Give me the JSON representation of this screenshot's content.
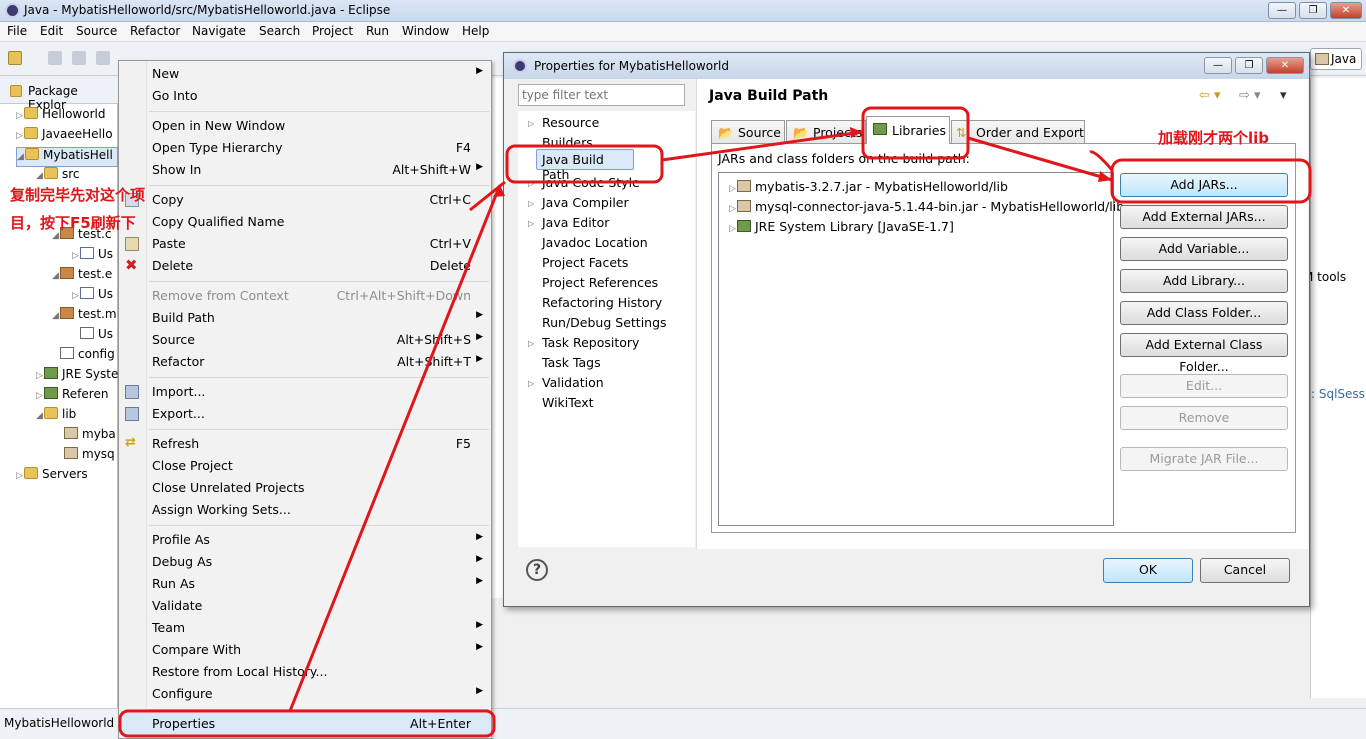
{
  "window": {
    "title": "Java - MybatisHelloworld/src/MybatisHelloworld.java - Eclipse",
    "minimize": "—",
    "maximize": "❐",
    "close": "✕"
  },
  "menubar": [
    "File",
    "Edit",
    "Source",
    "Refactor",
    "Navigate",
    "Search",
    "Project",
    "Run",
    "Window",
    "Help"
  ],
  "perspective": "Java",
  "package_explorer": {
    "title": "Package Explor",
    "rows": [
      {
        "label": "Helloworld",
        "icon": "project-icon"
      },
      {
        "label": "JavaeeHello",
        "icon": "project-icon"
      },
      {
        "label": "MybatisHell",
        "icon": "project-icon"
      },
      {
        "label": "src",
        "icon": "src-folder-icon"
      },
      {
        "label": "test.c",
        "icon": "package-icon"
      },
      {
        "label": "Us",
        "icon": "java-file-icon"
      },
      {
        "label": "test.e",
        "icon": "package-icon"
      },
      {
        "label": "Us",
        "icon": "java-file-icon"
      },
      {
        "label": "test.m",
        "icon": "package-icon"
      },
      {
        "label": "Us",
        "icon": "xml-file-icon"
      },
      {
        "label": "config",
        "icon": "xml-file-icon"
      },
      {
        "label": "JRE Syste",
        "icon": "library-icon"
      },
      {
        "label": "Referen",
        "icon": "library-icon"
      },
      {
        "label": "lib",
        "icon": "folder-icon"
      },
      {
        "label": "myba",
        "icon": "jar-icon"
      },
      {
        "label": "mysq",
        "icon": "jar-icon"
      },
      {
        "label": "Servers",
        "icon": "folder-icon"
      }
    ]
  },
  "status_bar": "MybatisHelloworld",
  "context_menu": {
    "items": [
      {
        "label": "New",
        "shortcut": "",
        "submenu": true
      },
      {
        "label": "Go Into",
        "shortcut": ""
      },
      {
        "label": "Open in New Window",
        "shortcut": ""
      },
      {
        "label": "Open Type Hierarchy",
        "shortcut": "F4"
      },
      {
        "label": "Show In",
        "shortcut": "Alt+Shift+W",
        "submenu": true
      },
      {
        "label": "Copy",
        "shortcut": "Ctrl+C"
      },
      {
        "label": "Copy Qualified Name",
        "shortcut": ""
      },
      {
        "label": "Paste",
        "shortcut": "Ctrl+V"
      },
      {
        "label": "Delete",
        "shortcut": "Delete"
      },
      {
        "label": "Remove from Context",
        "shortcut": "Ctrl+Alt+Shift+Down"
      },
      {
        "label": "Build Path",
        "shortcut": "",
        "submenu": true
      },
      {
        "label": "Source",
        "shortcut": "Alt+Shift+S",
        "submenu": true
      },
      {
        "label": "Refactor",
        "shortcut": "Alt+Shift+T",
        "submenu": true
      },
      {
        "label": "Import...",
        "shortcut": ""
      },
      {
        "label": "Export...",
        "shortcut": ""
      },
      {
        "label": "Refresh",
        "shortcut": "F5"
      },
      {
        "label": "Close Project",
        "shortcut": ""
      },
      {
        "label": "Close Unrelated Projects",
        "shortcut": ""
      },
      {
        "label": "Assign Working Sets...",
        "shortcut": ""
      },
      {
        "label": "Profile As",
        "shortcut": "",
        "submenu": true
      },
      {
        "label": "Debug As",
        "shortcut": "",
        "submenu": true
      },
      {
        "label": "Run As",
        "shortcut": "",
        "submenu": true
      },
      {
        "label": "Validate",
        "shortcut": ""
      },
      {
        "label": "Team",
        "shortcut": "",
        "submenu": true
      },
      {
        "label": "Compare With",
        "shortcut": "",
        "submenu": true
      },
      {
        "label": "Restore from Local History...",
        "shortcut": ""
      },
      {
        "label": "Configure",
        "shortcut": "",
        "submenu": true
      },
      {
        "label": "Properties",
        "shortcut": "Alt+Enter"
      }
    ]
  },
  "dialog": {
    "title": "Properties for MybatisHelloworld",
    "filter_placeholder": "type filter text",
    "nav": [
      "Resource",
      "Builders",
      "Java Build Path",
      "Java Code Style",
      "Java Compiler",
      "Java Editor",
      "Javadoc Location",
      "Project Facets",
      "Project References",
      "Refactoring History",
      "Run/Debug Settings",
      "Task Repository",
      "Task Tags",
      "Validation",
      "WikiText"
    ],
    "page_title": "Java Build Path",
    "tabs": [
      "Source",
      "Projects",
      "Libraries",
      "Order and Export"
    ],
    "jars_label": "JARs and class folders on the build path:",
    "entries": [
      "mybatis-3.2.7.jar - MybatisHelloworld/lib",
      "mysql-connector-java-5.1.44-bin.jar - MybatisHelloworld/lib",
      "JRE System Library [JavaSE-1.7]"
    ],
    "buttons": [
      "Add JARs...",
      "Add External JARs...",
      "Add Variable...",
      "Add Library...",
      "Add Class Folder...",
      "Add External Class Folder..."
    ],
    "buttons_disabled": [
      "Edit...",
      "Remove",
      "Migrate JAR File..."
    ],
    "ok": "OK",
    "cancel": "Cancel",
    "help": "?"
  },
  "annotations": {
    "left_line1": "复制完毕先对这个项",
    "left_line2": "目，按下F5刷新下",
    "right": "加载刚才两个lib"
  },
  "background_text": {
    "right_tools": "M tools",
    "right_sqlsess": ": SqlSess"
  },
  "colors": {
    "annotation": "#e0161b",
    "selection": "#dbe8f7"
  }
}
